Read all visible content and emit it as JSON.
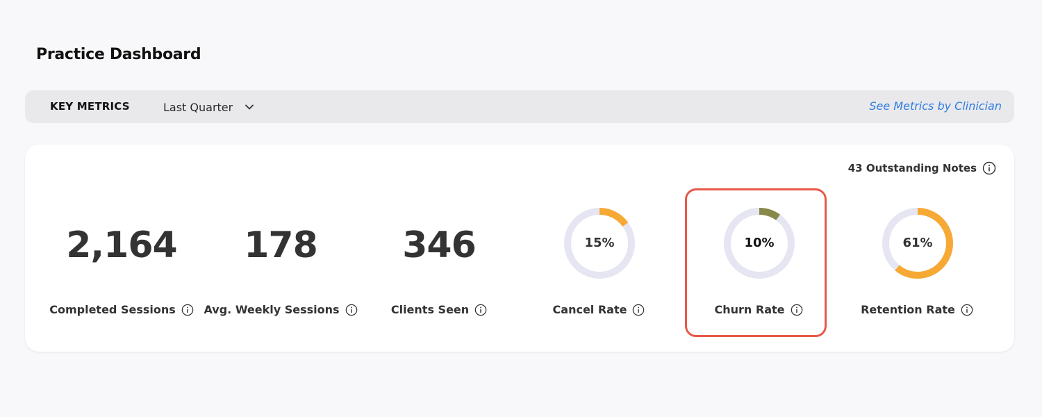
{
  "page": {
    "title": "Practice Dashboard"
  },
  "toolbar": {
    "key_metrics_label": "KEY METRICS",
    "period_selected": "Last Quarter",
    "clinician_link": "See Metrics by Clinician"
  },
  "card": {
    "outstanding_notes": "43 Outstanding Notes",
    "metrics": [
      {
        "value": "2,164",
        "label": "Completed Sessions"
      },
      {
        "value": "178",
        "label": "Avg. Weekly Sessions"
      },
      {
        "value": "346",
        "label": "Clients Seen"
      }
    ],
    "rates": [
      {
        "value_text": "15%",
        "percent": 15,
        "label": "Cancel Rate",
        "color": "#f7a935"
      },
      {
        "value_text": "10%",
        "percent": 10,
        "label": "Churn Rate",
        "color": "#87894a"
      },
      {
        "value_text": "61%",
        "percent": 61,
        "label": "Retention Rate",
        "color": "#f7a935"
      }
    ]
  },
  "colors": {
    "track": "#e6e6f2",
    "highlight": "#e8594a",
    "link": "#2f7de1"
  }
}
